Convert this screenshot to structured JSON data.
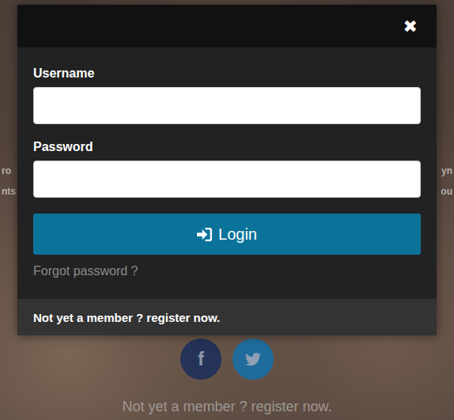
{
  "background": {
    "left_fragments": [
      "ro",
      "nts"
    ],
    "right_fragments": [
      "yn",
      "ou"
    ]
  },
  "modal": {
    "close": "✖",
    "fields": [
      {
        "label": "Username",
        "value": "",
        "kind": "text"
      },
      {
        "label": "Password",
        "value": "",
        "kind": "password"
      }
    ],
    "login_button": "Login",
    "forgot": "Forgot password ?",
    "footer": "Not yet a member ? register now."
  },
  "social": [
    {
      "name": "facebook",
      "glyph": "f",
      "color": "#243357"
    },
    {
      "name": "twitter",
      "glyph": "",
      "color": "#1f6c9c"
    }
  ],
  "register_link": "Not yet a member ? register now."
}
